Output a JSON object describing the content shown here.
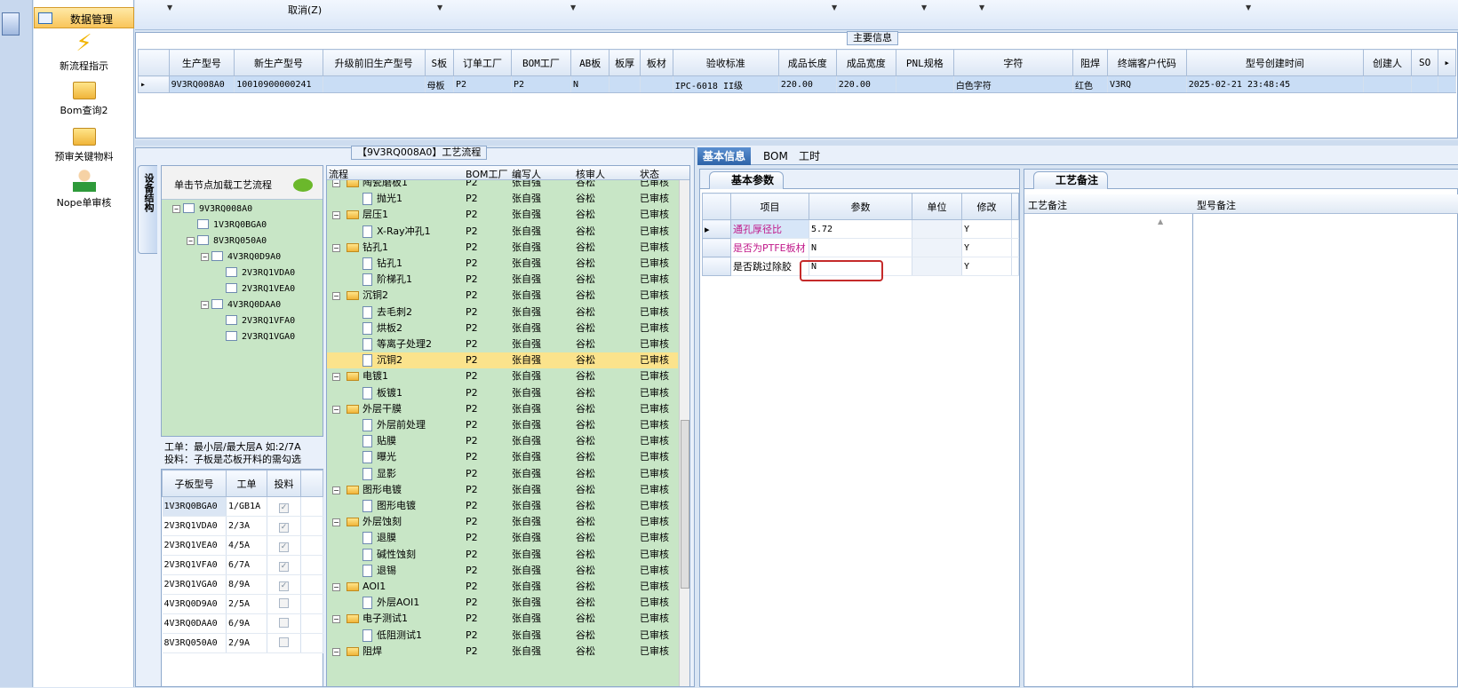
{
  "nav": {
    "selected_label": "数据管理",
    "items": [
      {
        "label": "新流程指示",
        "icon": "lightning-icon"
      },
      {
        "label": "Bom查询2",
        "icon": "folder-icon"
      },
      {
        "label": "预审关键物料",
        "icon": "folder-icon"
      },
      {
        "label": "Nope单审核",
        "icon": "user-icon"
      }
    ]
  },
  "toolbar": {
    "cancel_label": "取消(Z)"
  },
  "main_info": {
    "title": "主要信息",
    "columns": [
      "生产型号",
      "新生产型号",
      "升级前旧生产型号",
      "S板",
      "订单工厂",
      "BOM工厂",
      "AB板",
      "板厚",
      "板材",
      "验收标准",
      "成品长度",
      "成品宽度",
      "PNL规格",
      "字符",
      "阻焊",
      "终端客户代码",
      "型号创建时间",
      "创建人",
      "SO"
    ],
    "row": [
      "9V3RQ008A0",
      "10010900000241",
      "",
      "母板",
      "P2",
      "P2",
      "N",
      "",
      "",
      "IPC-6018 II级",
      "220.00",
      "220.00",
      "",
      "白色字符",
      "红色",
      "V3RQ",
      "2025-02-21 23:48:45",
      "",
      ""
    ]
  },
  "process": {
    "title": "【9V3RQ008A0】工艺流程",
    "vertical_tab": "设备结构",
    "tree_hint": "单击节点加载工艺流程",
    "tree": [
      {
        "label": "9V3RQ008A0",
        "level": 0,
        "expander": "−"
      },
      {
        "label": "1V3RQ0BGA0",
        "level": 1,
        "expander": ""
      },
      {
        "label": "8V3RQ050A0",
        "level": 1,
        "expander": "−"
      },
      {
        "label": "4V3RQ0D9A0",
        "level": 2,
        "expander": "−"
      },
      {
        "label": "2V3RQ1VDA0",
        "level": 3,
        "expander": ""
      },
      {
        "label": "2V3RQ1VEA0",
        "level": 3,
        "expander": ""
      },
      {
        "label": "4V3RQ0DAA0",
        "level": 2,
        "expander": "−"
      },
      {
        "label": "2V3RQ1VFA0",
        "level": 3,
        "expander": ""
      },
      {
        "label": "2V3RQ1VGA0",
        "level": 3,
        "expander": ""
      }
    ],
    "work_info_1": "工单：最小层/最大层A 如:2/7A",
    "work_info_2": "投料：子板是芯板开料的需勾选",
    "sub_columns": [
      "子板型号",
      "工单",
      "投料"
    ],
    "sub_rows": [
      {
        "model": "1V3RQ0BGA0",
        "order": "1/GB1A",
        "checked": true
      },
      {
        "model": "2V3RQ1VDA0",
        "order": "2/3A",
        "checked": true
      },
      {
        "model": "2V3RQ1VEA0",
        "order": "4/5A",
        "checked": true
      },
      {
        "model": "2V3RQ1VFA0",
        "order": "6/7A",
        "checked": true
      },
      {
        "model": "2V3RQ1VGA0",
        "order": "8/9A",
        "checked": true
      },
      {
        "model": "4V3RQ0D9A0",
        "order": "2/5A",
        "checked": false
      },
      {
        "model": "4V3RQ0DAA0",
        "order": "6/9A",
        "checked": false
      },
      {
        "model": "8V3RQ050A0",
        "order": "2/9A",
        "checked": false
      }
    ],
    "flow_columns": [
      "流程",
      "BOM工厂",
      "编写人",
      "核审人",
      "状态"
    ],
    "flow_rows": [
      {
        "type": "folder",
        "name": "陶瓷磨板1",
        "bom": "P2",
        "writer": "张自强",
        "reviewer": "谷松",
        "status": "已审核"
      },
      {
        "type": "doc",
        "name": "抛光1",
        "bom": "P2",
        "writer": "张自强",
        "reviewer": "谷松",
        "status": "已审核"
      },
      {
        "type": "folder",
        "name": "层压1",
        "bom": "P2",
        "writer": "张自强",
        "reviewer": "谷松",
        "status": "已审核"
      },
      {
        "type": "doc",
        "name": "X-Ray冲孔1",
        "bom": "P2",
        "writer": "张自强",
        "reviewer": "谷松",
        "status": "已审核"
      },
      {
        "type": "folder",
        "name": "钻孔1",
        "bom": "P2",
        "writer": "张自强",
        "reviewer": "谷松",
        "status": "已审核"
      },
      {
        "type": "doc",
        "name": "钻孔1",
        "bom": "P2",
        "writer": "张自强",
        "reviewer": "谷松",
        "status": "已审核"
      },
      {
        "type": "doc",
        "name": "阶梯孔1",
        "bom": "P2",
        "writer": "张自强",
        "reviewer": "谷松",
        "status": "已审核"
      },
      {
        "type": "folder",
        "name": "沉铜2",
        "bom": "P2",
        "writer": "张自强",
        "reviewer": "谷松",
        "status": "已审核"
      },
      {
        "type": "doc",
        "name": "去毛刺2",
        "bom": "P2",
        "writer": "张自强",
        "reviewer": "谷松",
        "status": "已审核"
      },
      {
        "type": "doc",
        "name": "烘板2",
        "bom": "P2",
        "writer": "张自强",
        "reviewer": "谷松",
        "status": "已审核"
      },
      {
        "type": "doc",
        "name": "等离子处理2",
        "bom": "P2",
        "writer": "张自强",
        "reviewer": "谷松",
        "status": "已审核"
      },
      {
        "type": "doc",
        "name": "沉铜2",
        "bom": "P2",
        "writer": "张自强",
        "reviewer": "谷松",
        "status": "已审核",
        "highlight": true
      },
      {
        "type": "folder",
        "name": "电镀1",
        "bom": "P2",
        "writer": "张自强",
        "reviewer": "谷松",
        "status": "已审核"
      },
      {
        "type": "doc",
        "name": "板镀1",
        "bom": "P2",
        "writer": "张自强",
        "reviewer": "谷松",
        "status": "已审核"
      },
      {
        "type": "folder",
        "name": "外层干膜",
        "bom": "P2",
        "writer": "张自强",
        "reviewer": "谷松",
        "status": "已审核"
      },
      {
        "type": "doc",
        "name": "外层前处理",
        "bom": "P2",
        "writer": "张自强",
        "reviewer": "谷松",
        "status": "已审核"
      },
      {
        "type": "doc",
        "name": "贴膜",
        "bom": "P2",
        "writer": "张自强",
        "reviewer": "谷松",
        "status": "已审核"
      },
      {
        "type": "doc",
        "name": "曝光",
        "bom": "P2",
        "writer": "张自强",
        "reviewer": "谷松",
        "status": "已审核"
      },
      {
        "type": "doc",
        "name": "显影",
        "bom": "P2",
        "writer": "张自强",
        "reviewer": "谷松",
        "status": "已审核"
      },
      {
        "type": "folder",
        "name": "图形电镀",
        "bom": "P2",
        "writer": "张自强",
        "reviewer": "谷松",
        "status": "已审核"
      },
      {
        "type": "doc",
        "name": "图形电镀",
        "bom": "P2",
        "writer": "张自强",
        "reviewer": "谷松",
        "status": "已审核"
      },
      {
        "type": "folder",
        "name": "外层蚀刻",
        "bom": "P2",
        "writer": "张自强",
        "reviewer": "谷松",
        "status": "已审核"
      },
      {
        "type": "doc",
        "name": "退膜",
        "bom": "P2",
        "writer": "张自强",
        "reviewer": "谷松",
        "status": "已审核"
      },
      {
        "type": "doc",
        "name": "碱性蚀刻",
        "bom": "P2",
        "writer": "张自强",
        "reviewer": "谷松",
        "status": "已审核"
      },
      {
        "type": "doc",
        "name": "退锡",
        "bom": "P2",
        "writer": "张自强",
        "reviewer": "谷松",
        "status": "已审核"
      },
      {
        "type": "folder",
        "name": "AOI1",
        "bom": "P2",
        "writer": "张自强",
        "reviewer": "谷松",
        "status": "已审核"
      },
      {
        "type": "doc",
        "name": "外层AOI1",
        "bom": "P2",
        "writer": "张自强",
        "reviewer": "谷松",
        "status": "已审核"
      },
      {
        "type": "folder",
        "name": "电子测试1",
        "bom": "P2",
        "writer": "张自强",
        "reviewer": "谷松",
        "status": "已审核"
      },
      {
        "type": "doc",
        "name": "低阻测试1",
        "bom": "P2",
        "writer": "张自强",
        "reviewer": "谷松",
        "status": "已审核"
      },
      {
        "type": "folder",
        "name": "阻焊",
        "bom": "P2",
        "writer": "张自强",
        "reviewer": "谷松",
        "status": "已审核"
      }
    ]
  },
  "right_tabs": [
    "基本信息",
    "BOM",
    "工时"
  ],
  "basic": {
    "tab": "基本参数",
    "columns": [
      "项目",
      "参数",
      "单位",
      "修改"
    ],
    "rows": [
      {
        "item": "通孔厚径比",
        "value": "5.72",
        "unit": "",
        "edit": "Y",
        "pink": true
      },
      {
        "item": "是否为PTFE板材",
        "value": "N",
        "unit": "",
        "edit": "Y",
        "pink": true
      },
      {
        "item": "是否跳过除胶",
        "value": "N",
        "unit": "",
        "edit": "Y",
        "pink": false
      }
    ]
  },
  "notes": {
    "tab": "工艺备注",
    "col1": "工艺备注",
    "col2": "型号备注"
  }
}
